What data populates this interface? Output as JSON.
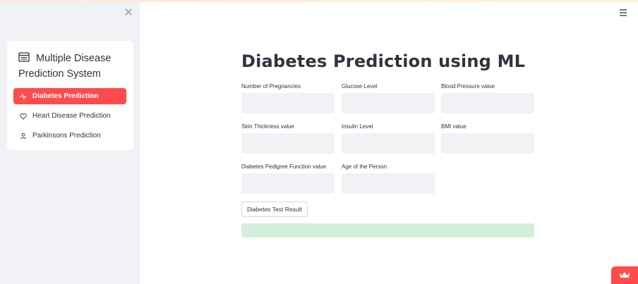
{
  "app": {
    "page_title": "Diabetes Prediction using ML",
    "accent_color": "#ff4b4b",
    "success_color": "#d4eedc"
  },
  "sidebar": {
    "close_icon": "close-icon",
    "close_glyph": "✕",
    "menu_title": "Multiple Disease Prediction System",
    "menu_title_icon": "clipboard-list-icon",
    "items": [
      {
        "label": "Diabetes Prediction",
        "icon": "activity-icon",
        "active": true
      },
      {
        "label": "Heart Disease Prediction",
        "icon": "heart-icon",
        "active": false
      },
      {
        "label": "Parkinsons Prediction",
        "icon": "person-icon",
        "active": false
      }
    ]
  },
  "header": {
    "menu_icon": "hamburger-menu-icon"
  },
  "form": {
    "fields": [
      {
        "label": "Number of Pregnancies",
        "value": ""
      },
      {
        "label": "Glucose Level",
        "value": ""
      },
      {
        "label": "Blood Pressure value",
        "value": ""
      },
      {
        "label": "Skin Thickness value",
        "value": ""
      },
      {
        "label": "Insulin Level",
        "value": ""
      },
      {
        "label": "BMI value",
        "value": ""
      },
      {
        "label": "Diabetes Pedigree Function value",
        "value": ""
      },
      {
        "label": "Age of the Person",
        "value": ""
      }
    ],
    "submit_label": "Diabetes Test Result",
    "result_text": ""
  },
  "footer": {
    "badge_icon": "crown-icon"
  }
}
